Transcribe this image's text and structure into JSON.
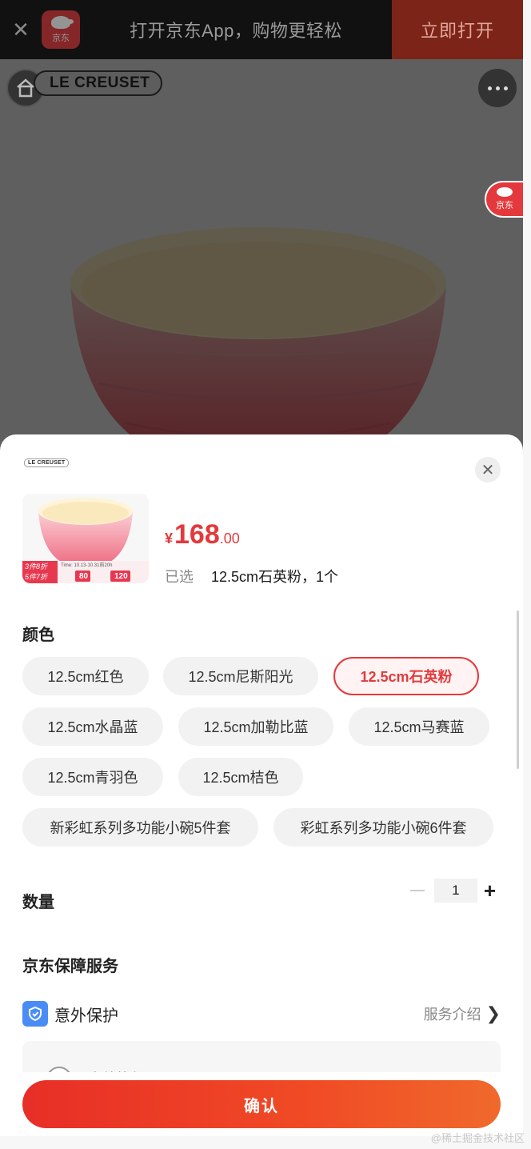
{
  "app_banner": {
    "close_icon": "close-icon",
    "logo_text": "京东",
    "text": "打开京东App，购物更轻松",
    "open_label": "立即打开"
  },
  "hero": {
    "brand": "LE CREUSET",
    "side_badge": "京东",
    "icons": [
      "home-icon",
      "more-icon"
    ]
  },
  "sheet": {
    "brand": "LE CREUSET",
    "close_icon": "close-icon",
    "thumb": {
      "promo_left_line1": "3件8折",
      "promo_left_line2": "5件7折",
      "promo_time": "Time: 10.13-10.31前20h",
      "tag1_value": "80",
      "tag2_value": "120"
    },
    "price": {
      "currency": "¥",
      "integer": "168",
      "decimal": ".00"
    },
    "selected": {
      "label": "已选",
      "value": "12.5cm石英粉，1个"
    },
    "color_title": "颜色",
    "colors": [
      {
        "label": "12.5cm红色",
        "active": false
      },
      {
        "label": "12.5cm尼斯阳光",
        "active": false
      },
      {
        "label": "12.5cm石英粉",
        "active": true
      },
      {
        "label": "12.5cm水晶蓝",
        "active": false
      },
      {
        "label": "12.5cm加勒比蓝",
        "active": false
      },
      {
        "label": "12.5cm马赛蓝",
        "active": false
      },
      {
        "label": "12.5cm青羽色",
        "active": false
      },
      {
        "label": "12.5cm桔色",
        "active": false
      },
      {
        "label": "新彩虹系列多功能小碗5件套",
        "active": false
      },
      {
        "label": "彩虹系列多功能小碗6件套",
        "active": false
      }
    ],
    "quantity_title": "数量",
    "quantity": "1",
    "plus": "+",
    "service_title": "京东保障服务",
    "service": {
      "name": "意外保护",
      "link": "服务介绍",
      "chevron": "❯",
      "option_text": "意外换新"
    },
    "confirm_label": "确认"
  },
  "watermark": "@稀土掘金技术社区",
  "colors_theme": {
    "accent": "#e4393c",
    "shield": "#4a8cf5"
  }
}
